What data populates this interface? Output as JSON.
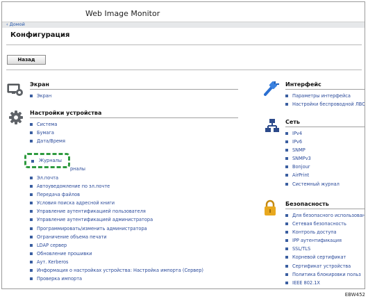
{
  "app": {
    "title": "Web Image Monitor",
    "home_link": "‹ Домой"
  },
  "page": {
    "title": "Конфигурация",
    "back_button": "Назад"
  },
  "left": {
    "screen": {
      "title": "Экран",
      "items": [
        "Экран"
      ]
    },
    "device": {
      "title": "Настройки устройства",
      "items_top": [
        "Система",
        "Бумага",
        "Дата/Время"
      ],
      "highlight": "Журналы",
      "partial_text": "рналы",
      "items_bottom": [
        "Эл.почта",
        "Автоуведомление по эл.почте",
        "Передача файлов",
        "Условия поиска адресной книги",
        "Управление аутентификацией пользователя",
        "Управление аутентификацией администратора",
        "Программировать/изменить администратора",
        "Ограничение объема печати",
        "LDAP сервер",
        "Обновление прошивки",
        "Аут. Kerberos",
        "Информация о настройках устройства: Настройка импорта (Сервер)",
        "Проверка импорта"
      ]
    }
  },
  "right": {
    "interface": {
      "title": "Интерфейс",
      "items": [
        "Параметры интерфейса",
        "Настройки беспроводной ЛВС"
      ]
    },
    "network": {
      "title": "Сеть",
      "items": [
        "IPv4",
        "IPv6",
        "SNMP",
        "SNMPv3",
        "Bonjour",
        "AirPrint",
        "Системный журнал"
      ]
    },
    "security": {
      "title": "Безопасность",
      "items": [
        "Для безопасного использован",
        "Сетевая безопасность",
        "Контроль доступа",
        "IPP аутентификация",
        "SSL/TLS",
        "Корневой сертификат",
        "Сертификат устройства",
        "Политика блокировки польз",
        "IEEE 802.1X"
      ]
    }
  },
  "figure_code": "EBW452",
  "colors": {
    "link": "#2a4a9a",
    "highlight": "#2e9a3e",
    "home_bar": "#e6e8ea"
  }
}
